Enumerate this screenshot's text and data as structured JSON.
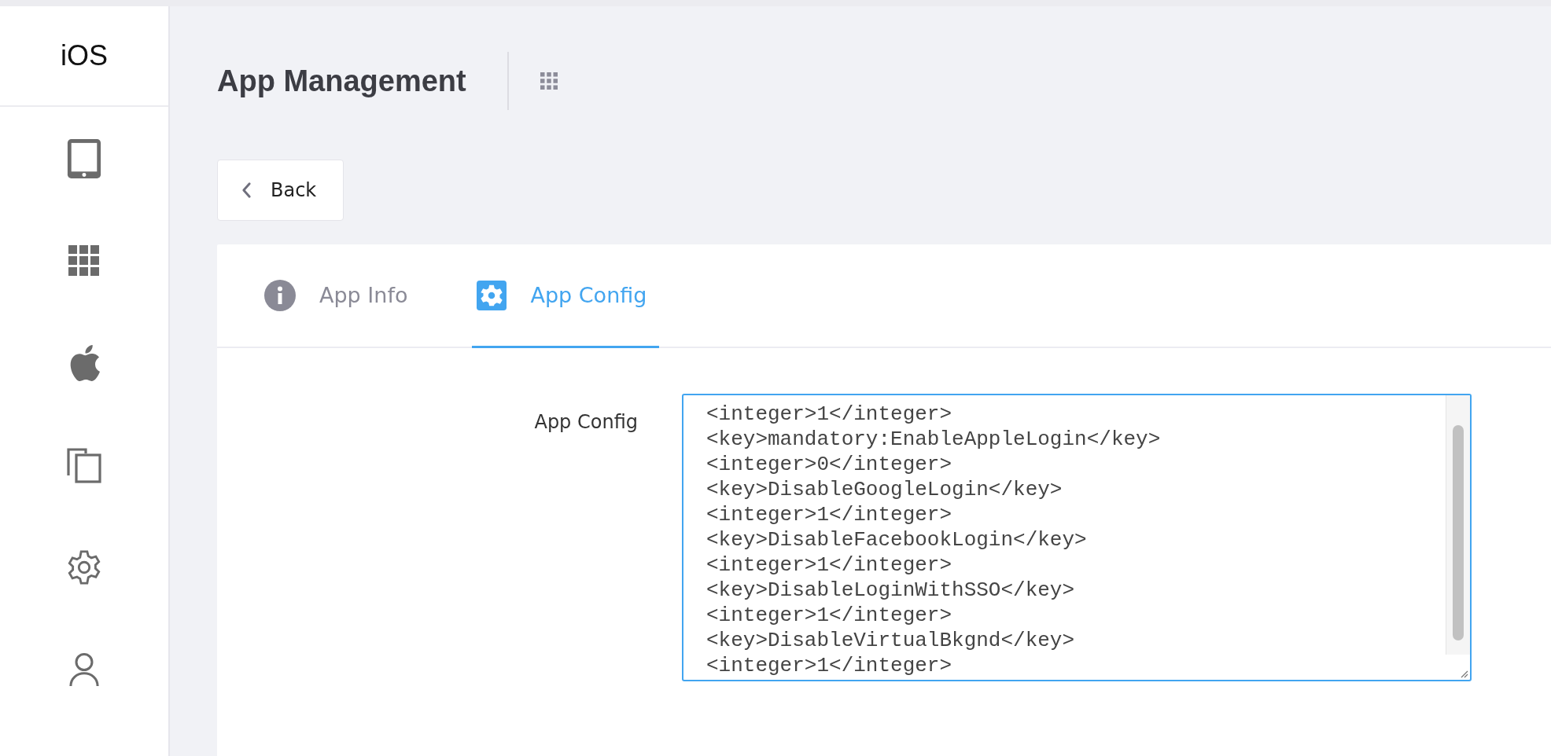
{
  "sidebar": {
    "title": "iOS",
    "items": [
      {
        "kind": "tablet"
      },
      {
        "kind": "grid"
      },
      {
        "kind": "apple"
      },
      {
        "kind": "copy"
      },
      {
        "kind": "gear"
      },
      {
        "kind": "person"
      }
    ]
  },
  "header": {
    "title": "App Management"
  },
  "back_button": {
    "label": "Back"
  },
  "tabs": [
    {
      "label": "App Info",
      "kind": "info",
      "selected": false
    },
    {
      "label": "App Config",
      "kind": "config",
      "selected": true
    }
  ],
  "form": {
    "label": "App Config",
    "value_lines": [
      "<integer>1</integer>",
      "<key>mandatory:EnableAppleLogin</key>",
      "<integer>0</integer>",
      "<key>DisableGoogleLogin</key>",
      "<integer>1</integer>",
      "<key>DisableFacebookLogin</key>",
      "<integer>1</integer>",
      "<key>DisableLoginWithSSO</key>",
      "<integer>1</integer>",
      "<key>DisableVirtualBkgnd</key>",
      "<integer>1</integer>"
    ]
  }
}
